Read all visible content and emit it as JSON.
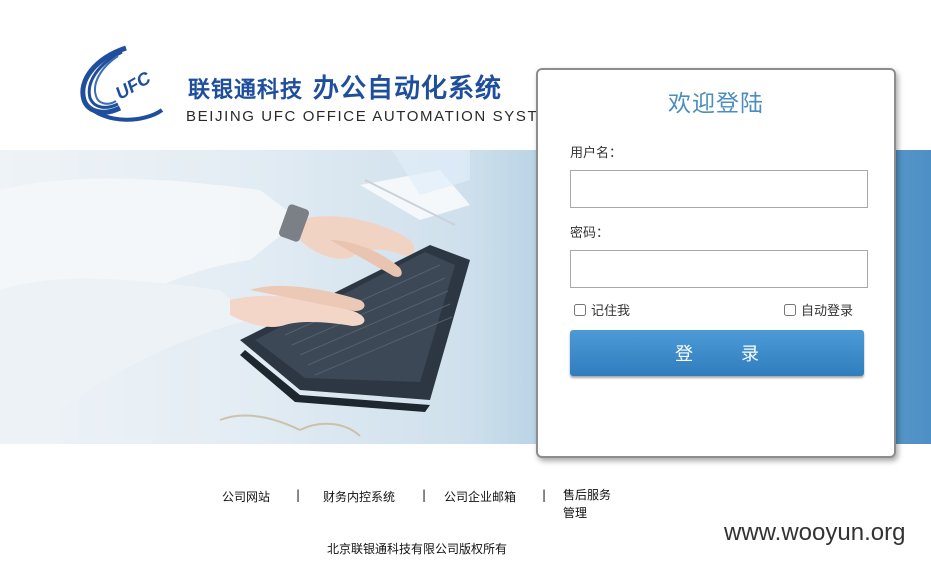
{
  "header": {
    "logo_text": "UFC",
    "company_cn": "联银通科技",
    "system_cn": "办公自动化系统",
    "system_en": "BEIJING  UFC  OFFICE  AUTOMATION  SYSTEM"
  },
  "login": {
    "title": "欢迎登陆",
    "username_label": "用户名：",
    "username_value": "",
    "password_label": "密码：",
    "password_value": "",
    "remember_label": "记住我",
    "remember_checked": false,
    "auto_login_label": "自动登录",
    "auto_login_checked": false,
    "submit_label": "登录"
  },
  "footer": {
    "links": [
      "公司网站",
      "财务内控系统",
      "公司企业邮箱",
      "售后服务管理"
    ],
    "separator": "|",
    "copyright": "北京联银通科技有限公司版权所有"
  },
  "watermark": "www.wooyun.org",
  "colors": {
    "brand_blue": "#1f4f9c",
    "title_blue": "#4b8dbd",
    "button_blue": "#3a8ac9"
  }
}
